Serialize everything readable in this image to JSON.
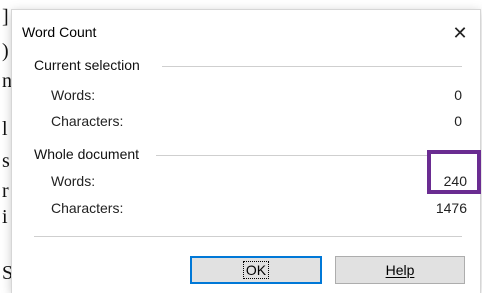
{
  "dialog": {
    "title": "Word Count",
    "close_icon": "close-icon",
    "current_selection": {
      "label": "Current selection",
      "words_label": "Words:",
      "words_value": "0",
      "characters_label": "Characters:",
      "characters_value": "0"
    },
    "whole_document": {
      "label": "Whole document",
      "words_label": "Words:",
      "words_value": "240",
      "characters_label": "Characters:",
      "characters_value": "1476"
    },
    "buttons": {
      "ok_label": "OK",
      "help_label": "Help"
    }
  },
  "colors": {
    "highlight_border": "#6a2c91",
    "default_button_border": "#0078d7"
  }
}
